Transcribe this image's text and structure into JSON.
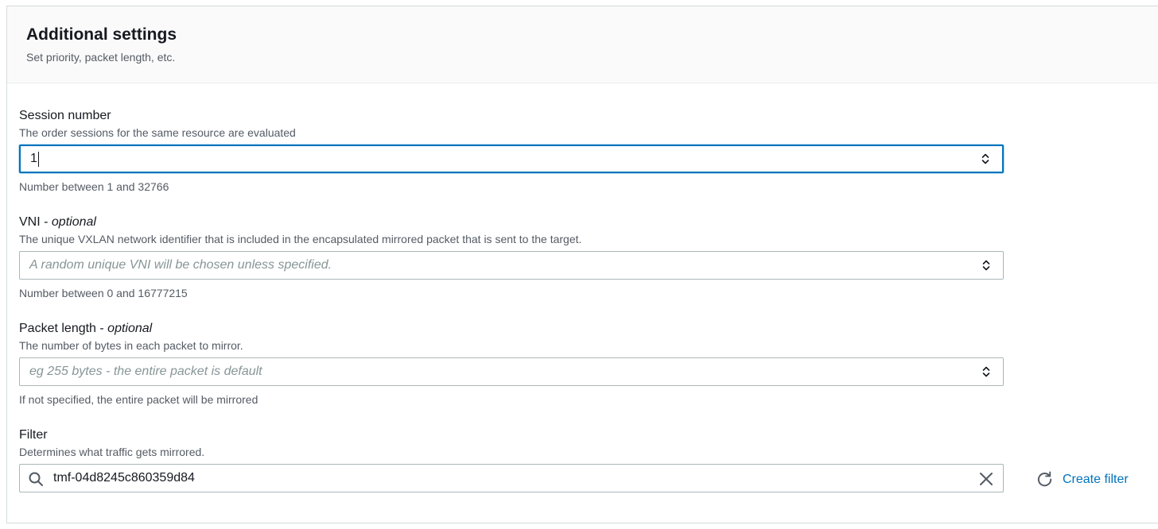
{
  "header": {
    "title": "Additional settings",
    "subtitle": "Set priority, packet length, etc."
  },
  "session_number": {
    "label": "Session number",
    "description": "The order sessions for the same resource are evaluated",
    "value": "1",
    "hint": "Number between 1 and 32766"
  },
  "vni": {
    "label": "VNI - ",
    "label_optional": "optional",
    "description": "The unique VXLAN network identifier that is included in the encapsulated mirrored packet that is sent to the target.",
    "placeholder": "A random unique VNI will be chosen unless specified.",
    "hint": "Number between 0 and 16777215"
  },
  "packet_length": {
    "label": "Packet length - ",
    "label_optional": "optional",
    "description": "The number of bytes in each packet to mirror.",
    "placeholder": "eg 255 bytes - the entire packet is default",
    "hint": "If not specified, the entire packet will be mirrored"
  },
  "filter": {
    "label": "Filter",
    "description": "Determines what traffic gets mirrored.",
    "value": "tmf-04d8245c860359d84",
    "create_link": "Create filter"
  },
  "icons": {
    "search": "search-icon",
    "clear": "close-icon",
    "refresh": "refresh-icon",
    "stepper": "stepper-icon"
  },
  "colors": {
    "focus_border": "#0073bb",
    "link": "#0073bb",
    "muted_text": "#545b64",
    "placeholder": "#879596"
  }
}
